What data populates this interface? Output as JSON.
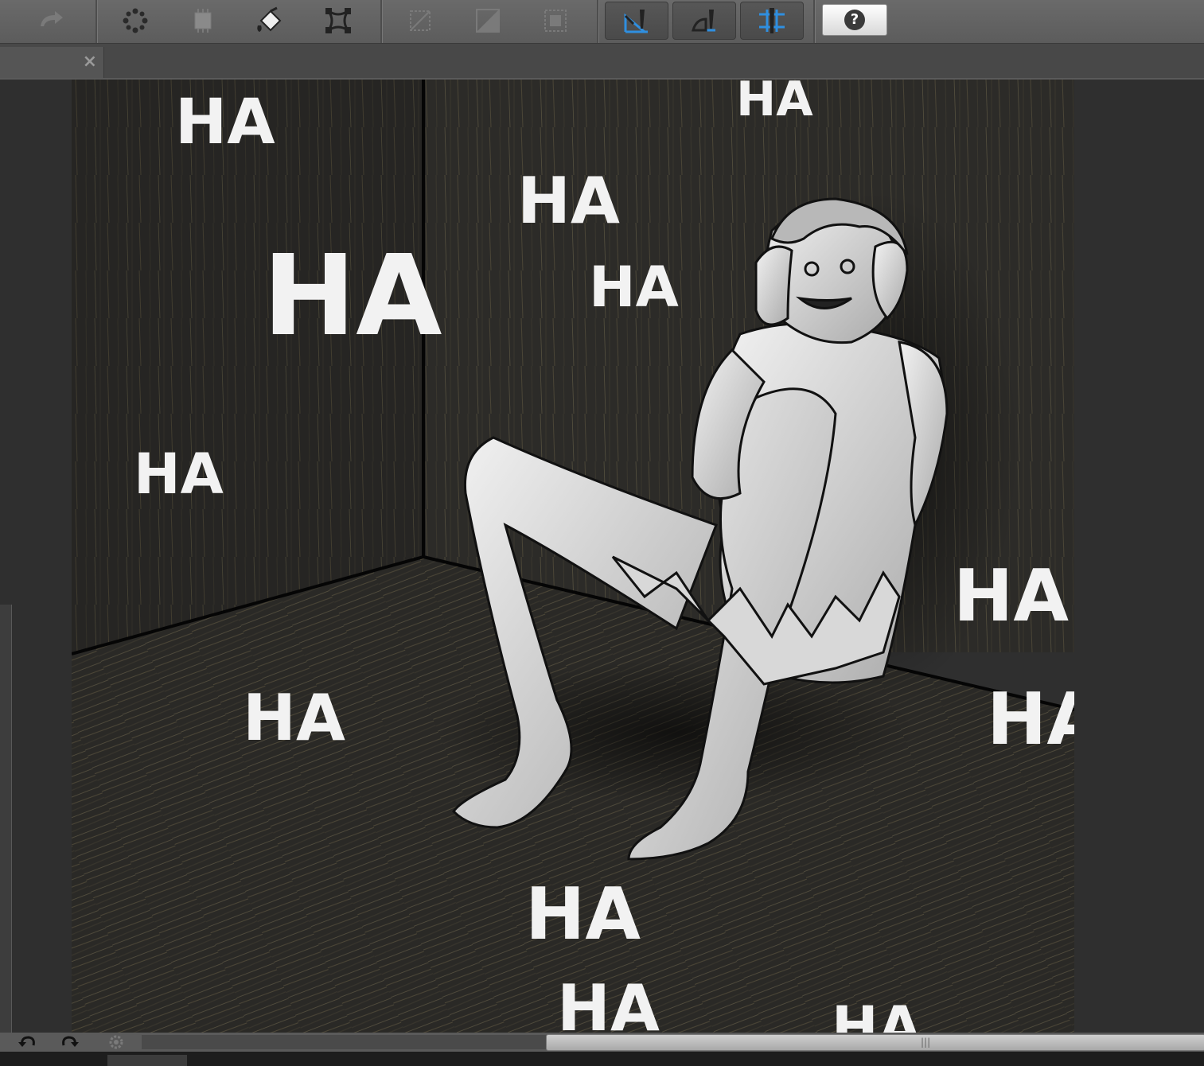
{
  "toolbar": {
    "buttons": [
      {
        "icon": "redo-icon"
      },
      {
        "icon": "selection-dots-icon"
      },
      {
        "icon": "layer-chip-icon"
      },
      {
        "icon": "fill-bucket-icon"
      },
      {
        "icon": "transform-icon"
      },
      {
        "icon": "ruler-disabled-icon"
      },
      {
        "icon": "gradient-disabled-icon"
      },
      {
        "icon": "frame-disabled-icon"
      },
      {
        "icon": "perspective-ruler-icon",
        "active": true
      },
      {
        "icon": "curve-ruler-icon",
        "active": true
      },
      {
        "icon": "symmetry-ruler-icon",
        "active": true
      },
      {
        "icon": "help-icon"
      }
    ],
    "help_label": "?"
  },
  "document_tab": {
    "close_label": "×"
  },
  "artwork": {
    "sound_effects": [
      "HA",
      "HA",
      "HA",
      "HA",
      "HA",
      "HA",
      "HA",
      "HA",
      "HA",
      "HA",
      "HA",
      "HA",
      "HA"
    ]
  },
  "bottombar": {
    "icons": [
      "rotate-left-icon",
      "rotate-right-icon",
      "settings-gear-icon"
    ],
    "scroll_grip": "|||"
  },
  "colors": {
    "toolbar": "#5f5f5f",
    "accent_blue": "#2f8fe0",
    "canvas_bg": "#2f2f2f",
    "artwork_dark": "#2b2a27"
  }
}
